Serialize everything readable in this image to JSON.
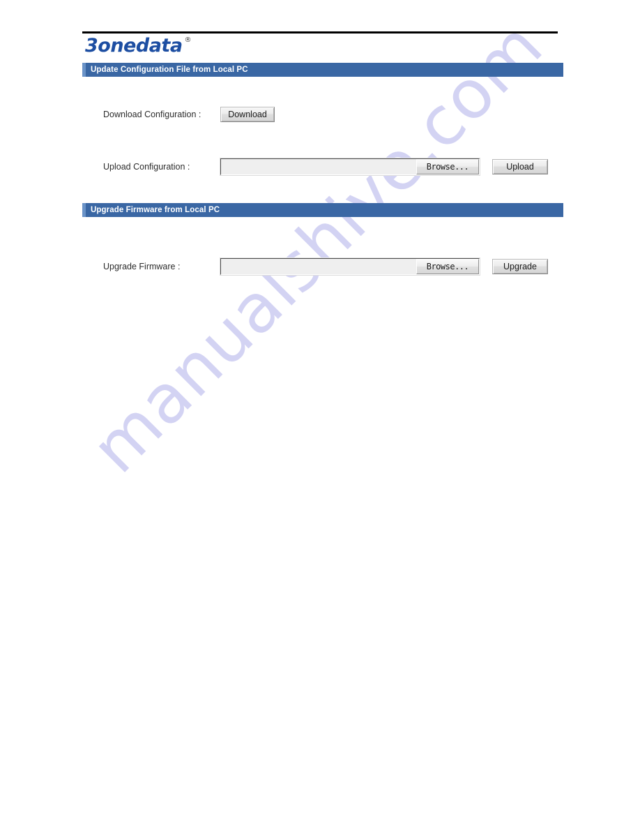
{
  "brand": {
    "logo_text": "3onedata",
    "registered_mark": "®"
  },
  "watermark": {
    "text": "manualshive.com",
    "color": "#ccccf2"
  },
  "theme": {
    "header_bar_color": "#3a67a4",
    "header_bar_accent": "#6a93c8",
    "logo_color": "#1d4ea2",
    "rule_color": "#000000"
  },
  "sections": [
    {
      "id": "update-configuration",
      "title": "Update Configuration File from Local PC",
      "rows": [
        {
          "id": "download-configuration",
          "label": "Download Configuration :",
          "button_label": "Download"
        },
        {
          "id": "upload-configuration",
          "label": "Upload Configuration :",
          "file_value": "",
          "file_placeholder": "",
          "browse_label": "Browse...",
          "button_label": "Upload"
        }
      ]
    },
    {
      "id": "upgrade-firmware",
      "title": "Upgrade Firmware from Local PC",
      "rows": [
        {
          "id": "upgrade-firmware-row",
          "label": "Upgrade Firmware :",
          "file_value": "",
          "file_placeholder": "",
          "browse_label": "Browse...",
          "button_label": "Upgrade"
        }
      ]
    }
  ]
}
